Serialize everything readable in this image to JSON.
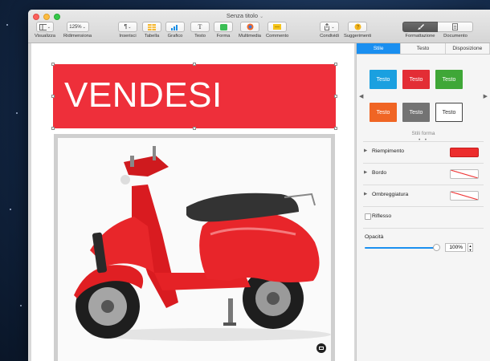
{
  "window": {
    "title": "Senza titolo",
    "title_chevron": "⌄"
  },
  "toolbar": {
    "view_label": "Visualizza",
    "zoom_value": "125%",
    "zoom_label": "Ridimensiona",
    "insert_label": "Inserisci",
    "table_label": "Tabella",
    "chart_label": "Grafico",
    "text_label": "Testo",
    "shape_label": "Forma",
    "media_label": "Multimedia",
    "comment_label": "Commento",
    "share_label": "Condividi",
    "tips_label": "Suggerimenti",
    "format_label": "Formattazione",
    "document_label": "Documento"
  },
  "document": {
    "banner_text": "VENDESI",
    "banner_color": "#ee2f3a"
  },
  "inspector": {
    "tabs": [
      {
        "label": "Stile",
        "active": true
      },
      {
        "label": "Testo",
        "active": false
      },
      {
        "label": "Disposizione",
        "active": false
      }
    ],
    "styles": [
      {
        "label": "Testo",
        "color": "#1aa0e0"
      },
      {
        "label": "Testo",
        "color": "#e32d35"
      },
      {
        "label": "Testo",
        "color": "#3fa737"
      },
      {
        "label": "Testo",
        "color": "#f06524"
      },
      {
        "label": "Testo",
        "color": "#737373"
      },
      {
        "label": "Testo",
        "color": "#ffffff"
      }
    ],
    "styles_caption": "Stili forma",
    "page_dots": "• •",
    "fill_label": "Riempimento",
    "fill_color": "#ec2d2d",
    "border_label": "Bordo",
    "shadow_label": "Ombreggiatura",
    "reflection_label": "Riflesso",
    "opacity_label": "Opacità",
    "opacity_value": "100%",
    "opacity": 1.0
  }
}
